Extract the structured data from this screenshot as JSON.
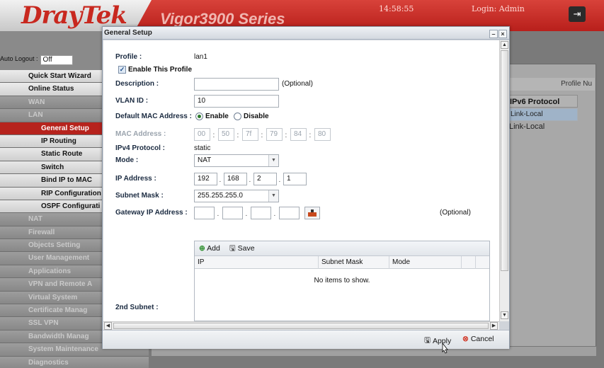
{
  "header": {
    "brand": "DrayTek",
    "series": "Vigor3900 Series",
    "time": "14:58:55",
    "login": "Login: Admin",
    "logout_icon": "logout-icon"
  },
  "sidebar": {
    "auto_logout_label": "Auto Logout :",
    "auto_logout_value": "Off",
    "items": [
      {
        "label": "Quick Start Wizard",
        "style": "light"
      },
      {
        "label": "Online Status",
        "style": "light"
      },
      {
        "label": "WAN",
        "style": "grey"
      },
      {
        "label": "LAN",
        "style": "grey"
      },
      {
        "label": "General Setup",
        "style": "active"
      },
      {
        "label": "IP Routing",
        "style": "sub"
      },
      {
        "label": "Static Route",
        "style": "sub"
      },
      {
        "label": "Switch",
        "style": "sub"
      },
      {
        "label": "Bind IP to MAC",
        "style": "sub"
      },
      {
        "label": "RIP Configuration",
        "style": "sub"
      },
      {
        "label": "OSPF Configurati",
        "style": "sub"
      },
      {
        "label": "NAT",
        "style": "grey"
      },
      {
        "label": "Firewall",
        "style": "grey"
      },
      {
        "label": "Objects Setting",
        "style": "grey"
      },
      {
        "label": "User Management",
        "style": "grey"
      },
      {
        "label": "Applications",
        "style": "grey"
      },
      {
        "label": "VPN and Remote A",
        "style": "grey"
      },
      {
        "label": "Virtual System",
        "style": "grey"
      },
      {
        "label": "Certificate Manag",
        "style": "grey"
      },
      {
        "label": "SSL VPN",
        "style": "grey"
      },
      {
        "label": "Bandwidth Manag",
        "style": "grey"
      },
      {
        "label": "System Maintenance",
        "style": "grey"
      },
      {
        "label": "Diagnostics",
        "style": "grey"
      }
    ]
  },
  "background_table": {
    "profile_header": "Profile Nu",
    "column": "IPv6 Protocol",
    "rows": [
      "Link-Local",
      "Link-Local"
    ]
  },
  "dialog": {
    "title": "General Setup",
    "minimize": "–",
    "close": "×",
    "profile_label": "Profile :",
    "profile_value": "lan1",
    "enable_profile_label": "Enable This Profile",
    "description_label": "Description :",
    "description_value": "",
    "optional": "(Optional)",
    "vlan_label": "VLAN ID :",
    "vlan_value": "10",
    "default_mac_label": "Default MAC Address :",
    "enable_label": "Enable",
    "disable_label": "Disable",
    "mac_label": "MAC Address :",
    "mac": [
      "00",
      "50",
      "7f",
      "79",
      "84",
      "80"
    ],
    "ipv4_label": "IPv4 Protocol :",
    "ipv4_value": "static",
    "mode_label": "Mode :",
    "mode_value": "NAT",
    "ip_label": "IP Address :",
    "ip": [
      "192",
      "168",
      "2",
      "1"
    ],
    "mask_label": "Subnet Mask :",
    "mask_value": "255.255.255.0",
    "gateway_label": "Gateway IP Address :",
    "gateway": [
      "",
      "",
      "",
      ""
    ],
    "gateway_optional": "(Optional)",
    "subnet2_label": "2nd Subnet :",
    "grid": {
      "add": "Add",
      "save": "Save",
      "columns": [
        "IP",
        "Subnet Mask",
        "Mode"
      ],
      "empty": "No items to show."
    },
    "apply": "Apply",
    "cancel": "Cancel"
  }
}
